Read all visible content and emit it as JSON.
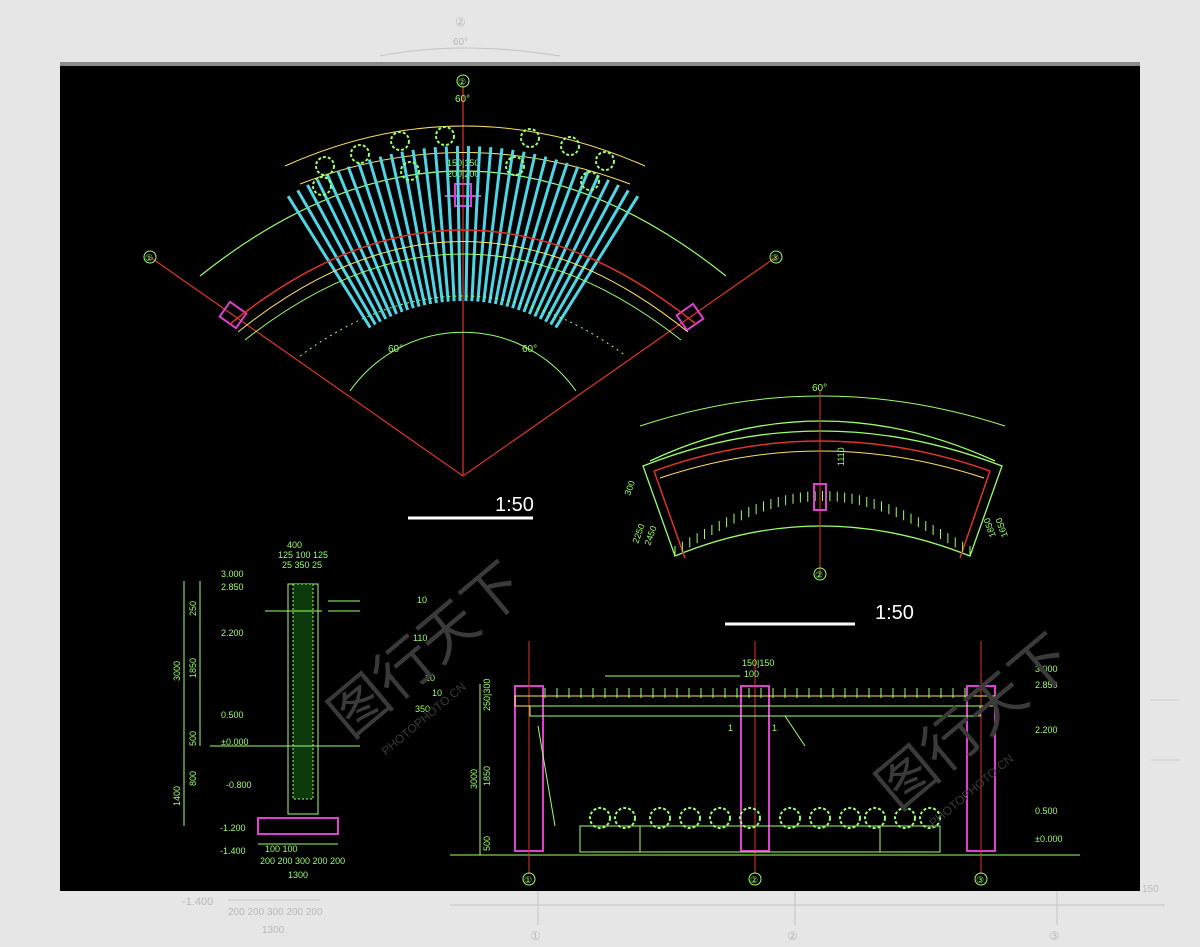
{
  "sheet": {
    "scale_label_1": "1:50",
    "scale_label_2": "1:50",
    "watermark_cn": "图行天下",
    "watermark_en": "PHOTOPHOTO.CN"
  },
  "plan_top": {
    "axis_top": "②",
    "axis_left": "①",
    "axis_right": "③",
    "angle_top": "60°",
    "angle_left": "60°",
    "angle_right": "60°",
    "dim_center": "150|150",
    "dim_center_2": "200|200"
  },
  "plan_right": {
    "axis_bottom": "②",
    "angle_top": "60°",
    "dim_1": "1110",
    "dim_left_1": "300",
    "dim_left_2": "2250",
    "dim_left_3": "2450",
    "dim_right_1": "1850",
    "dim_right_2": "1650"
  },
  "section": {
    "top_width": "400",
    "top_parts": "125 100 125",
    "top_parts_2": "25 350 25",
    "elev_3000": "3.000",
    "elev_2850": "2.850",
    "elev_2200": "2.200",
    "elev_0500": "0.500",
    "elev_0000": "±0.000",
    "elev_m0800": "-0.800",
    "elev_m1200": "-1.200",
    "elev_m1400": "-1.400",
    "dim_3000": "3000",
    "dim_1850": "1850",
    "dim_500": "500",
    "dim_1400": "1400",
    "dim_250": "250",
    "dim_10": "10",
    "dim_110": "110",
    "dim_20": "20",
    "dim_10b": "10",
    "dim_350": "350",
    "dim_800": "800",
    "bottom_parts": "100  100",
    "bottom_parts_2": "200 200 300 200 200",
    "bottom_total": "1300"
  },
  "elevation": {
    "dim_top": "150|150",
    "dim_top_2": "100",
    "marker_1": "1",
    "marker_2": "1",
    "elev_3000": "3.000",
    "elev_2850": "2.850",
    "elev_2200": "2.200",
    "elev_0500": "0.500",
    "elev_0000": "±0.000",
    "dim_3000": "3000",
    "dim_1850": "1850",
    "dim_500": "500",
    "dim_250": "250|300",
    "axis_1": "①",
    "axis_2": "②",
    "axis_3": "③"
  },
  "ghost": {
    "axis_top": "②",
    "angle_top": "60°",
    "elev": "-1.400",
    "bottom_parts": "200 200 300 200 200",
    "bottom_total": "1300",
    "axis_1": "①",
    "axis_2": "②",
    "axis_3": "③",
    "num": "150"
  },
  "colors": {
    "background": "#000000",
    "green": "#9cff6a",
    "cyan": "#4fd6e6",
    "red": "#e0332a",
    "magenta": "#e040d0",
    "yellow": "#ffe066",
    "white": "#ffffff"
  }
}
